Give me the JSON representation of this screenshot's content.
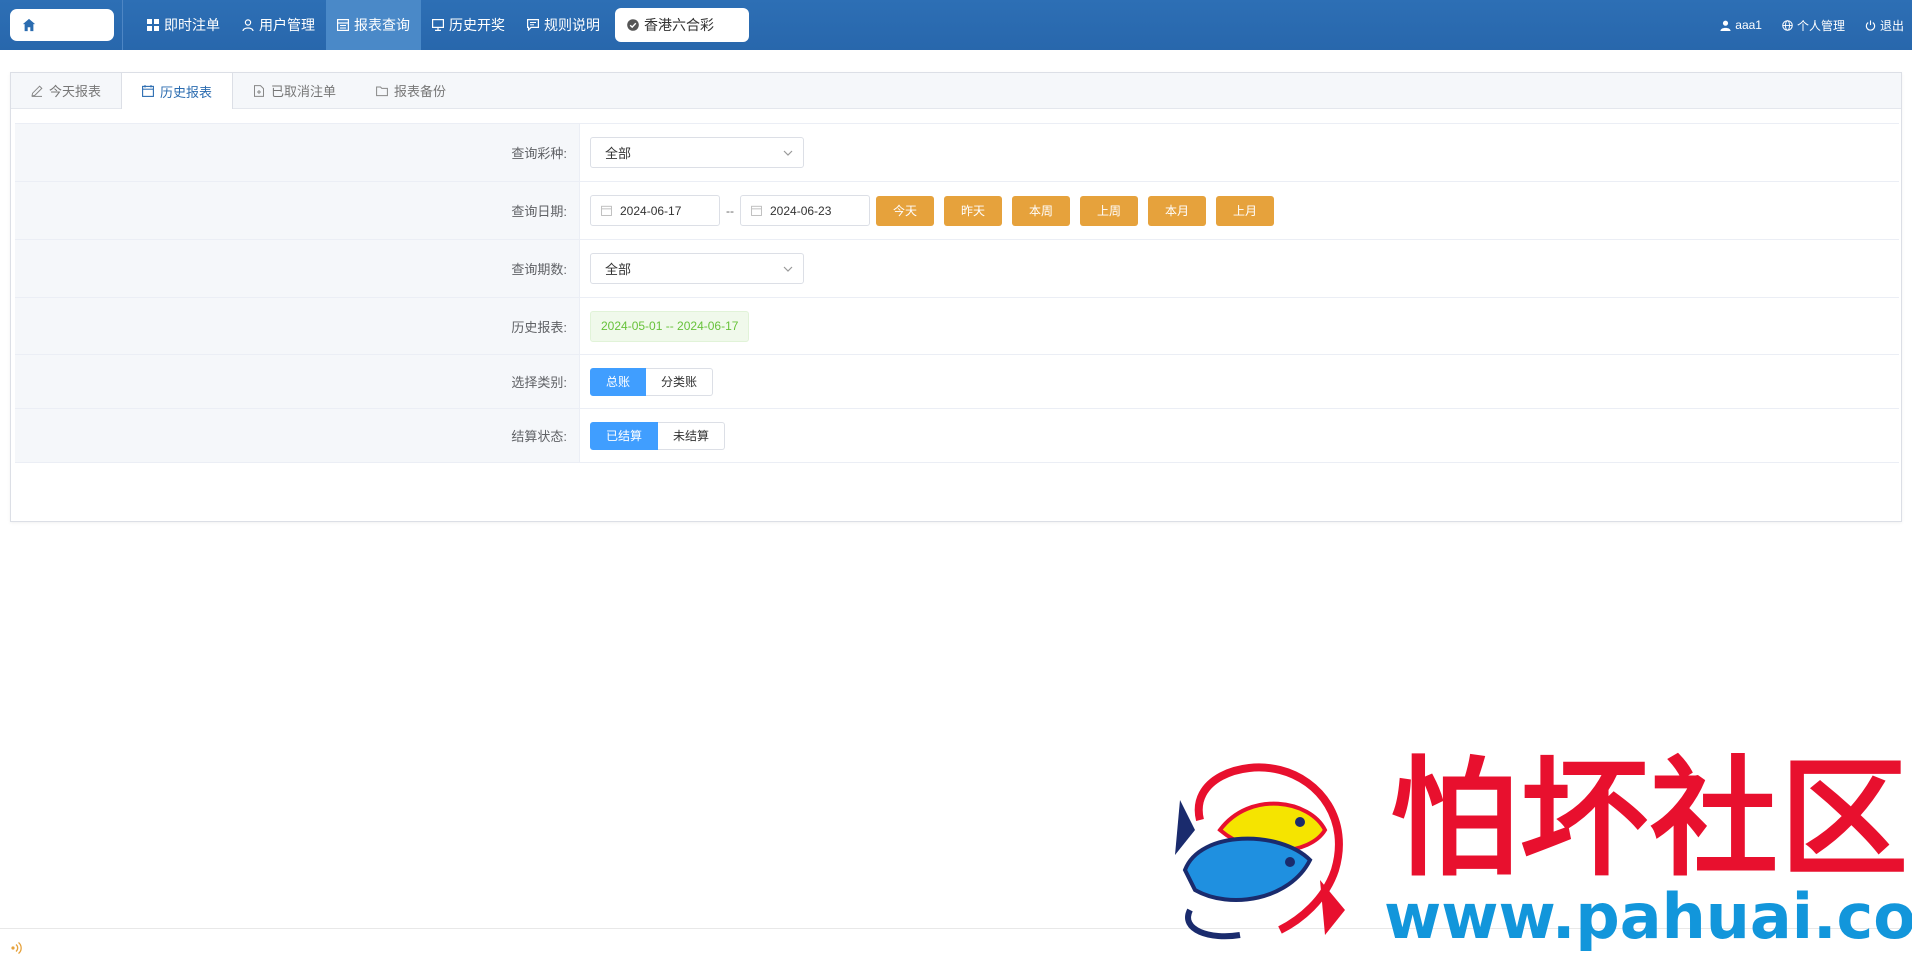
{
  "nav": {
    "items": [
      {
        "label": "即时注单",
        "icon": "grid-icon"
      },
      {
        "label": "用户管理",
        "icon": "user-icon"
      },
      {
        "label": "报表查询",
        "icon": "report-icon",
        "active": true
      },
      {
        "label": "历史开奖",
        "icon": "monitor-icon"
      },
      {
        "label": "规则说明",
        "icon": "chat-icon"
      }
    ],
    "lottery": {
      "label": "香港六合彩",
      "icon": "check-circle-icon"
    }
  },
  "user": {
    "name": "aaa1",
    "profile_label": "个人管理",
    "logout_label": "退出"
  },
  "tabs": [
    {
      "label": "今天报表",
      "icon": "pencil-icon"
    },
    {
      "label": "历史报表",
      "icon": "calendar-icon",
      "active": true
    },
    {
      "label": "已取消注单",
      "icon": "file-icon"
    },
    {
      "label": "报表备份",
      "icon": "folder-icon"
    }
  ],
  "form": {
    "lottery_type": {
      "label": "查询彩种:",
      "value": "全部"
    },
    "date": {
      "label": "查询日期:",
      "start": "2024-06-17",
      "separator": "--",
      "end": "2024-06-23",
      "quick": [
        "今天",
        "昨天",
        "本周",
        "上周",
        "本月",
        "上月"
      ]
    },
    "period": {
      "label": "查询期数:",
      "value": "全部"
    },
    "history": {
      "label": "历史报表:",
      "range": "2024-05-01 -- 2024-06-17"
    },
    "category": {
      "label": "选择类别:",
      "options": [
        "总账",
        "分类账"
      ],
      "selected": "总账"
    },
    "settle": {
      "label": "结算状态:",
      "options": [
        "已结算",
        "未结算"
      ],
      "selected": "已结算"
    }
  },
  "watermark": {
    "title": "怕坏社区",
    "url": "www.pahuai.com"
  },
  "colors": {
    "topbar": "#2b6cb0",
    "quick_button": "#e6a23c",
    "segment_on": "#409eff",
    "history_tag": "#67c23a"
  }
}
